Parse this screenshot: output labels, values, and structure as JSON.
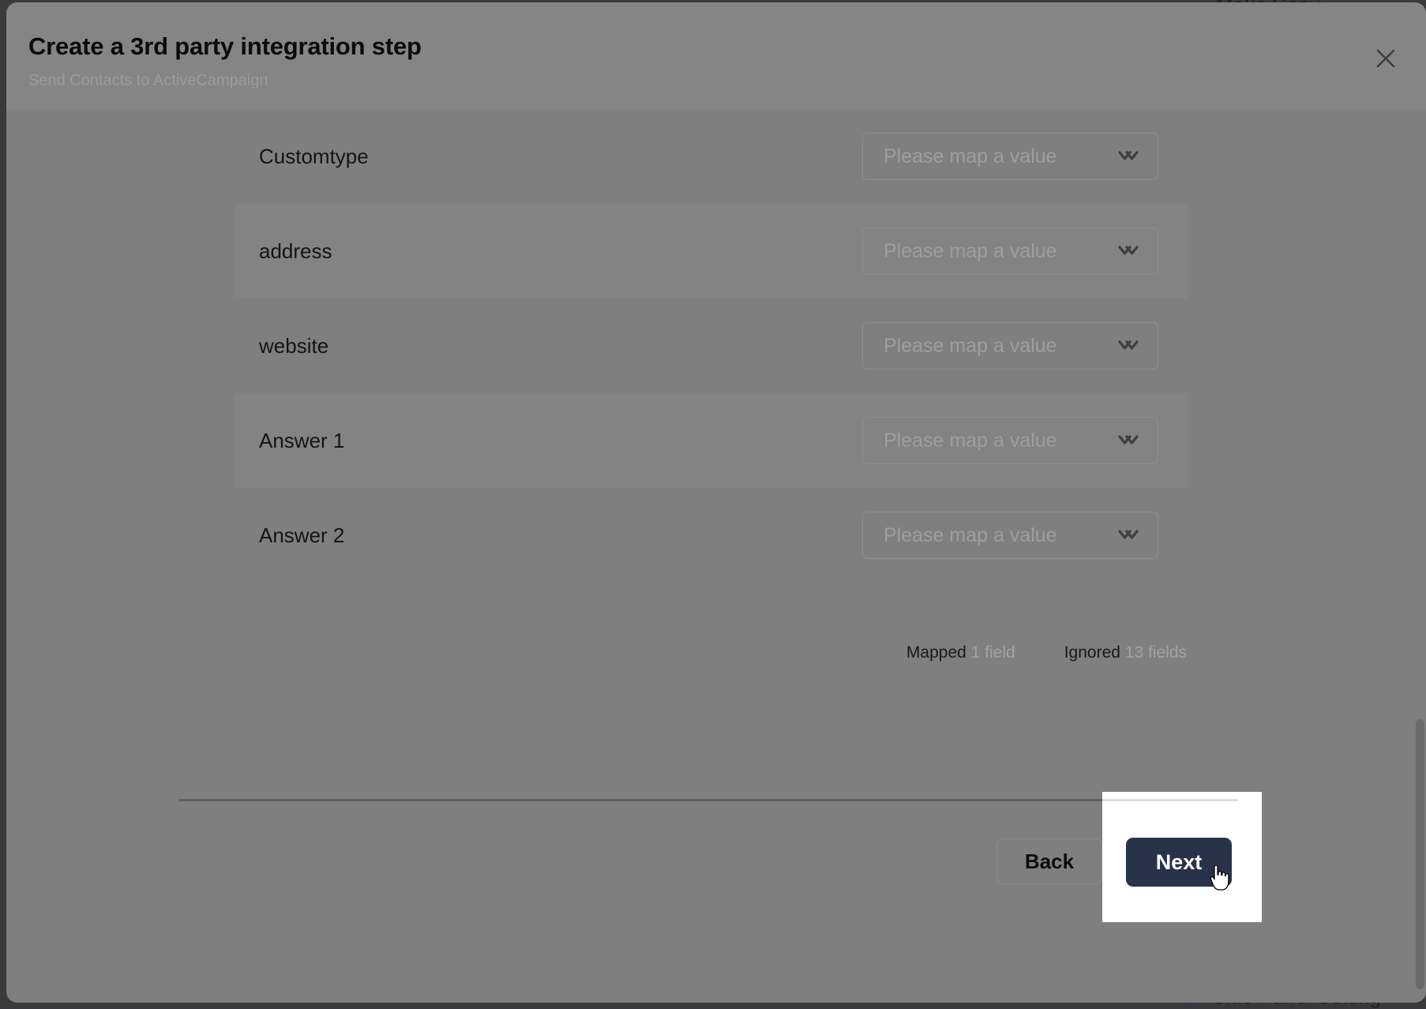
{
  "background": {
    "top_text": "Make Copy",
    "bottom_text": "Side Panel Setting"
  },
  "modal": {
    "title": "Create a 3rd party integration step",
    "subtitle": "Send Contacts to ActiveCampaign",
    "close_icon": "close-icon",
    "mapping": {
      "select_placeholder": "Please map a value",
      "chevron_icon": "chevron-double-down-icon",
      "rows": [
        {
          "label": "Customtype",
          "value": "",
          "alt": false
        },
        {
          "label": "address",
          "value": "",
          "alt": true
        },
        {
          "label": "website",
          "value": "",
          "alt": false
        },
        {
          "label": "Answer 1",
          "value": "",
          "alt": true
        },
        {
          "label": "Answer 2",
          "value": "",
          "alt": false
        }
      ],
      "summary": {
        "mapped_label": "Mapped",
        "mapped_value": "1 field",
        "ignored_label": "Ignored",
        "ignored_value": "13 fields"
      }
    },
    "footer": {
      "back_label": "Back",
      "next_label": "Next"
    }
  },
  "colors": {
    "overlay_gray": "#7f7f7f",
    "header_gray": "#858585",
    "alt_row_gray": "#838383",
    "next_navy": "#28334a",
    "spotlight_white": "#ffffff",
    "placeholder_gray": "#9e9e9e",
    "text_black": "#141416"
  }
}
